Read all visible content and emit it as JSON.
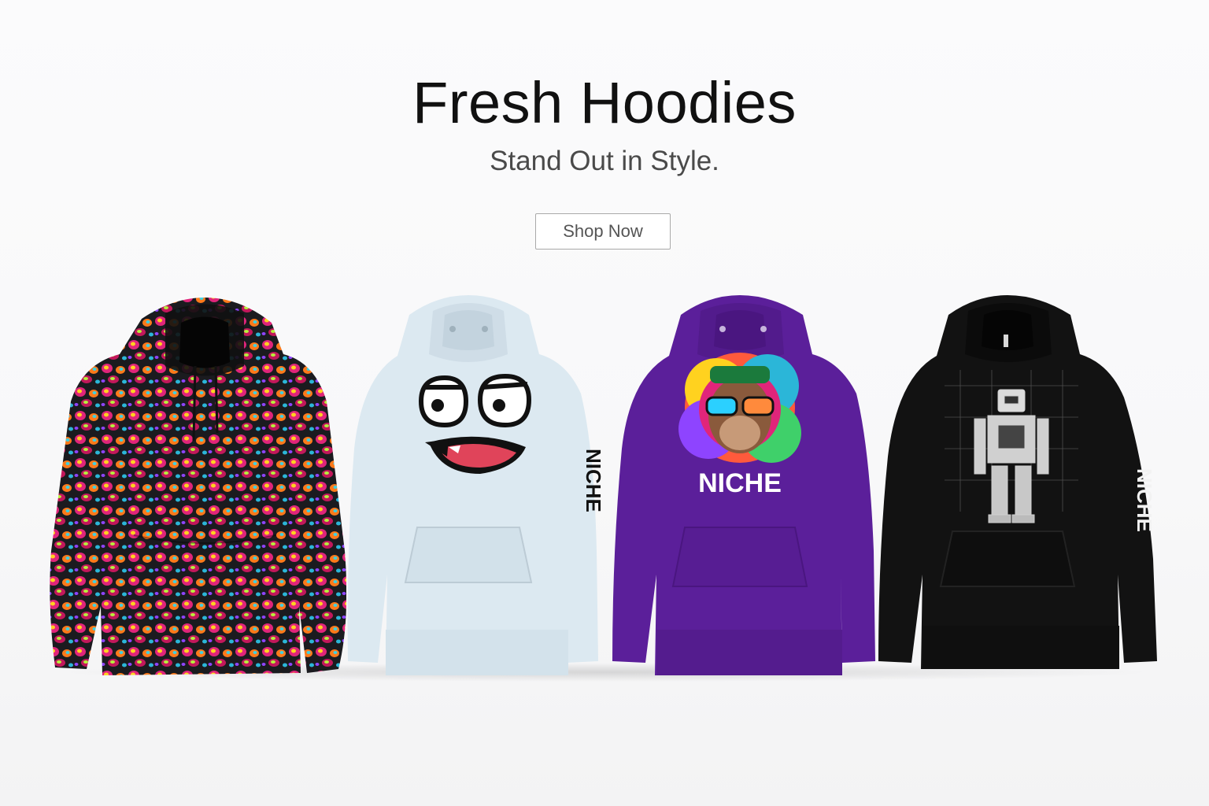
{
  "hero": {
    "title": "Fresh Hoodies",
    "subtitle": "Stand Out in Style.",
    "cta_label": "Shop Now"
  },
  "products": [
    {
      "color": "#1a1a1a",
      "design": "colorful-cartoon-pattern-print"
    },
    {
      "color": "#dce9f1",
      "design": "bored-cartoon-face-graphic",
      "sleeve_text": "NICHE"
    },
    {
      "color": "#5b1f9a",
      "design": "colorful-monkey-sunglasses-graphic",
      "front_text": "NICHE"
    },
    {
      "color": "#111111",
      "design": "robot-blueprint-graphic",
      "sleeve_text": "NICHE"
    }
  ]
}
